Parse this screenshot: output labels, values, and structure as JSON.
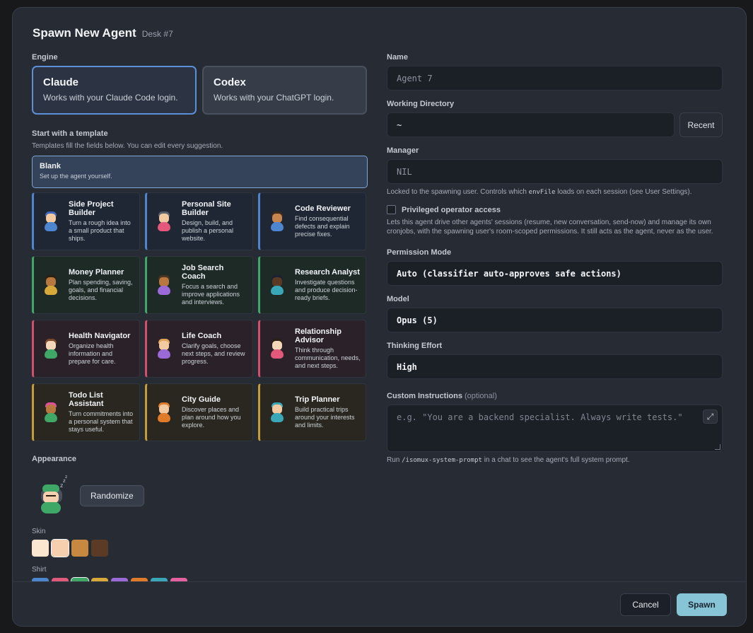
{
  "header": {
    "title": "Spawn New Agent",
    "desk": "Desk #7"
  },
  "engine": {
    "label": "Engine",
    "options": [
      {
        "name": "Claude",
        "desc": "Works with your Claude Code login.",
        "selected": true
      },
      {
        "name": "Codex",
        "desc": "Works with your ChatGPT login.",
        "selected": false
      }
    ]
  },
  "templates": {
    "label": "Start with a template",
    "note": "Templates fill the fields below. You can edit every suggestion.",
    "blank": {
      "title": "Blank",
      "desc": "Set up the agent yourself."
    },
    "items": [
      {
        "title": "Side Project Builder",
        "desc": "Turn a rough idea into a small product that ships.",
        "accent": "#4d86cf",
        "hair": "#3e67b8",
        "skin": "#f2c9a0",
        "shirt": "#4d86cf"
      },
      {
        "title": "Personal Site Builder",
        "desc": "Design, build, and publish a personal website.",
        "accent": "#4d86cf",
        "hair": "#5a5f6b",
        "skin": "#f2c9a0",
        "shirt": "#e3587b"
      },
      {
        "title": "Code Reviewer",
        "desc": "Find consequential defects and explain precise fixes.",
        "accent": "#4d86cf",
        "hair": "#3e2a1c",
        "skin": "#c88550",
        "shirt": "#4d86cf"
      },
      {
        "title": "Money Planner",
        "desc": "Plan spending, saving, goals, and financial decisions.",
        "accent": "#3fa866",
        "hair": "#2b2015",
        "skin": "#b8773f",
        "shirt": "#d9a83a"
      },
      {
        "title": "Job Search Coach",
        "desc": "Focus a search and improve applications and interviews.",
        "accent": "#3fa866",
        "hair": "#4b3421",
        "skin": "#b8773f",
        "shirt": "#9b6ad9"
      },
      {
        "title": "Research Analyst",
        "desc": "Investigate questions and produce decision-ready briefs.",
        "accent": "#3fa866",
        "hair": "#1d2233",
        "skin": "#5a3a25",
        "shirt": "#3aa7b8"
      },
      {
        "title": "Health Navigator",
        "desc": "Organize health information and prepare for care.",
        "accent": "#d24e6a",
        "hair": "#7a4a2a",
        "skin": "#f4d7b8",
        "shirt": "#3fa866"
      },
      {
        "title": "Life Coach",
        "desc": "Clarify goals, choose next steps, and review progress.",
        "accent": "#d24e6a",
        "hair": "#e2a35b",
        "skin": "#f2c9a0",
        "shirt": "#9b6ad9"
      },
      {
        "title": "Relationship Advisor",
        "desc": "Think through communication, needs, and next steps.",
        "accent": "#d24e6a",
        "hair": "#2b2015",
        "skin": "#f4d7b8",
        "shirt": "#e3587b"
      },
      {
        "title": "Todo List Assistant",
        "desc": "Turn commitments into a personal system that stays useful.",
        "accent": "#c89d38",
        "hair": "#e04f9a",
        "skin": "#b8773f",
        "shirt": "#3fa866"
      },
      {
        "title": "City Guide",
        "desc": "Discover places and plan around how you explore.",
        "accent": "#c89d38",
        "hair": "#e07b2a",
        "skin": "#f2c9a0",
        "shirt": "#e07b2a"
      },
      {
        "title": "Trip Planner",
        "desc": "Build practical trips around your interests and limits.",
        "accent": "#c89d38",
        "hair": "#3aa7b8",
        "skin": "#f2c9a0",
        "shirt": "#3aa7b8"
      }
    ]
  },
  "appearance": {
    "label": "Appearance",
    "randomize": "Randomize",
    "sleep_glyph": "z",
    "skin_label": "Skin",
    "skin": [
      "#fbe7cf",
      "#f6cfae",
      "#c6893f",
      "#5b3a26"
    ],
    "shirt_label": "Shirt",
    "shirt": [
      "#4d86cf",
      "#e05a7a",
      "#3fa866",
      "#d9a83a",
      "#9b6ad9",
      "#e07b2a",
      "#3aa7b8",
      "#e5609f"
    ]
  },
  "form": {
    "name_label": "Name",
    "name_placeholder": "Agent 7",
    "wd_label": "Working Directory",
    "wd_value": "~",
    "recent": "Recent",
    "manager_label": "Manager",
    "manager_value": "NIL",
    "manager_note_a": "Locked to the spawning user. Controls which ",
    "manager_note_code": "envFile",
    "manager_note_b": " loads on each session (see User Settings).",
    "priv_label": "Privileged operator access",
    "priv_note": "Lets this agent drive other agents' sessions (resume, new conversation, send-now) and manage its own cronjobs, with the spawning user's room-scoped permissions. It still acts as the agent, never as the user.",
    "perm_label": "Permission Mode",
    "perm_value": "Auto (classifier auto-approves safe actions)",
    "model_label": "Model",
    "model_value": "Opus (5)",
    "effort_label": "Thinking Effort",
    "effort_value": "High",
    "ci_label": "Custom Instructions",
    "ci_optional": "(optional)",
    "ci_placeholder": "e.g. \"You are a backend specialist. Always write tests.\"",
    "run_note_a": "Run ",
    "run_note_code": "/isomux-system-prompt",
    "run_note_b": " in a chat to see the agent's full system prompt."
  },
  "footer": {
    "cancel": "Cancel",
    "spawn": "Spawn"
  }
}
